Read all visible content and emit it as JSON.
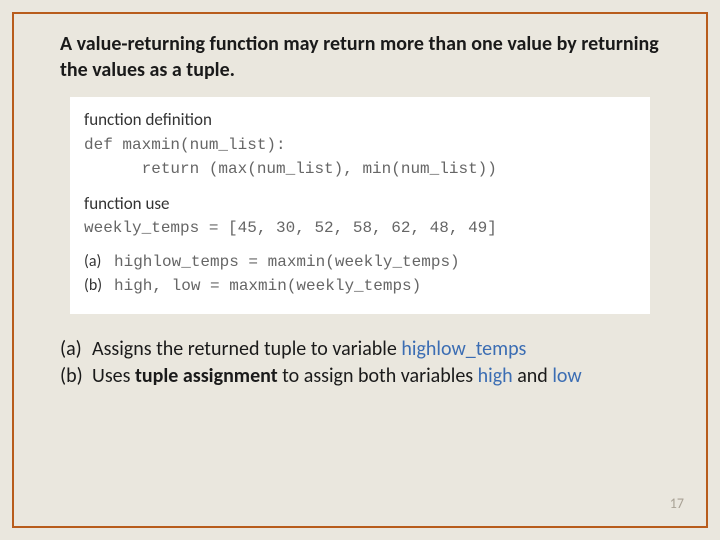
{
  "headline": "A value-returning function may return more than one value by returning the values as a tuple.",
  "code": {
    "sec1_label": "function definition",
    "def_line": "def maxmin(num_list):",
    "ret_line": "      return (max(num_list), min(num_list))",
    "sec2_label": "function use",
    "weekly_line": "weekly_temps = [45, 30, 52, 58, 62, 48, 49]",
    "tag_a": "(a)",
    "line_a": "highlow_temps = maxmin(weekly_temps)",
    "tag_b": "(b)",
    "line_b": "high, low = maxmin(weekly_temps)"
  },
  "explain": {
    "a_label": "(a)",
    "a_pre": "Assigns the returned tuple to variable ",
    "a_hl": "highlow_temps",
    "b_label": "(b)",
    "b_pre": "Uses ",
    "b_bold": "tuple assignment",
    "b_mid": " to assign both variables ",
    "b_hl1": "high",
    "b_and": " and ",
    "b_hl2": "low"
  },
  "page_number": "17"
}
